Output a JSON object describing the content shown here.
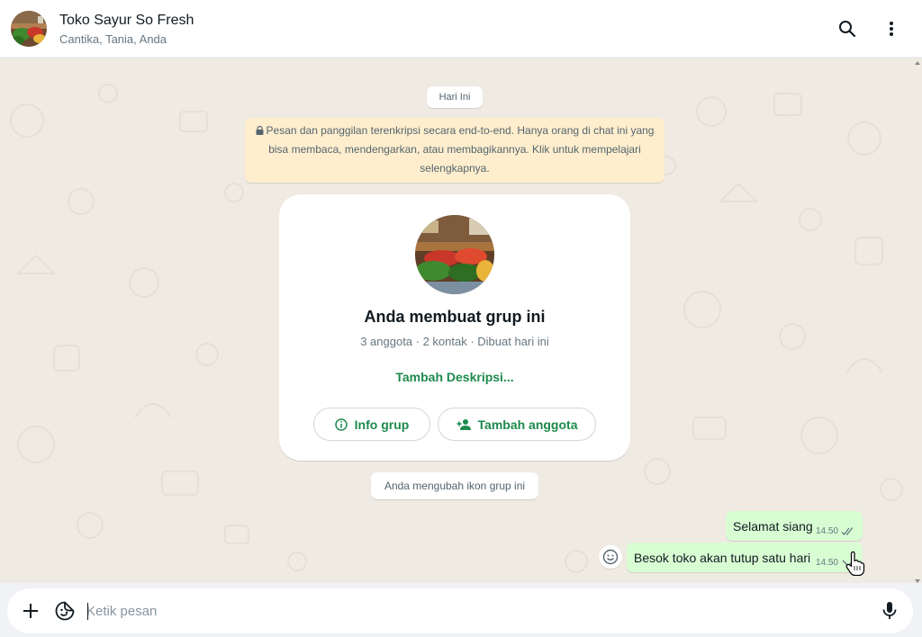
{
  "header": {
    "title": "Toko Sayur So Fresh",
    "subtitle": "Cantika, Tania, Anda",
    "avatar_icon": "group-photo-vegetables",
    "search_icon": "search-icon",
    "menu_icon": "menu-dots-icon"
  },
  "chat": {
    "date_label": "Hari Ini",
    "encryption_notice": "Pesan dan panggilan terenkripsi secara end-to-end. Hanya orang di chat ini yang bisa membaca, mendengarkan, atau membagikannya. Klik untuk mempelajari selengkapnya.",
    "group_card": {
      "title": "Anda membuat grup ini",
      "meta": "3 anggota · 2 kontak · Dibuat hari ini",
      "add_description": "Tambah Deskripsi...",
      "info_button": "Info grup",
      "add_member_button": "Tambah anggota"
    },
    "system_message": "Anda mengubah ikon grup ini",
    "messages": [
      {
        "text": "Selamat siang",
        "time": "14.50",
        "status": "read"
      },
      {
        "text": "Besok toko akan tutup satu hari",
        "time": "14.50",
        "status": "read"
      }
    ]
  },
  "composer": {
    "placeholder": "Ketik pesan",
    "value": ""
  },
  "colors": {
    "accent": "#1e8a4c",
    "bubble_out": "#d9fdd3",
    "notice_bg": "#ffeecd",
    "chat_bg": "#efeae2"
  }
}
